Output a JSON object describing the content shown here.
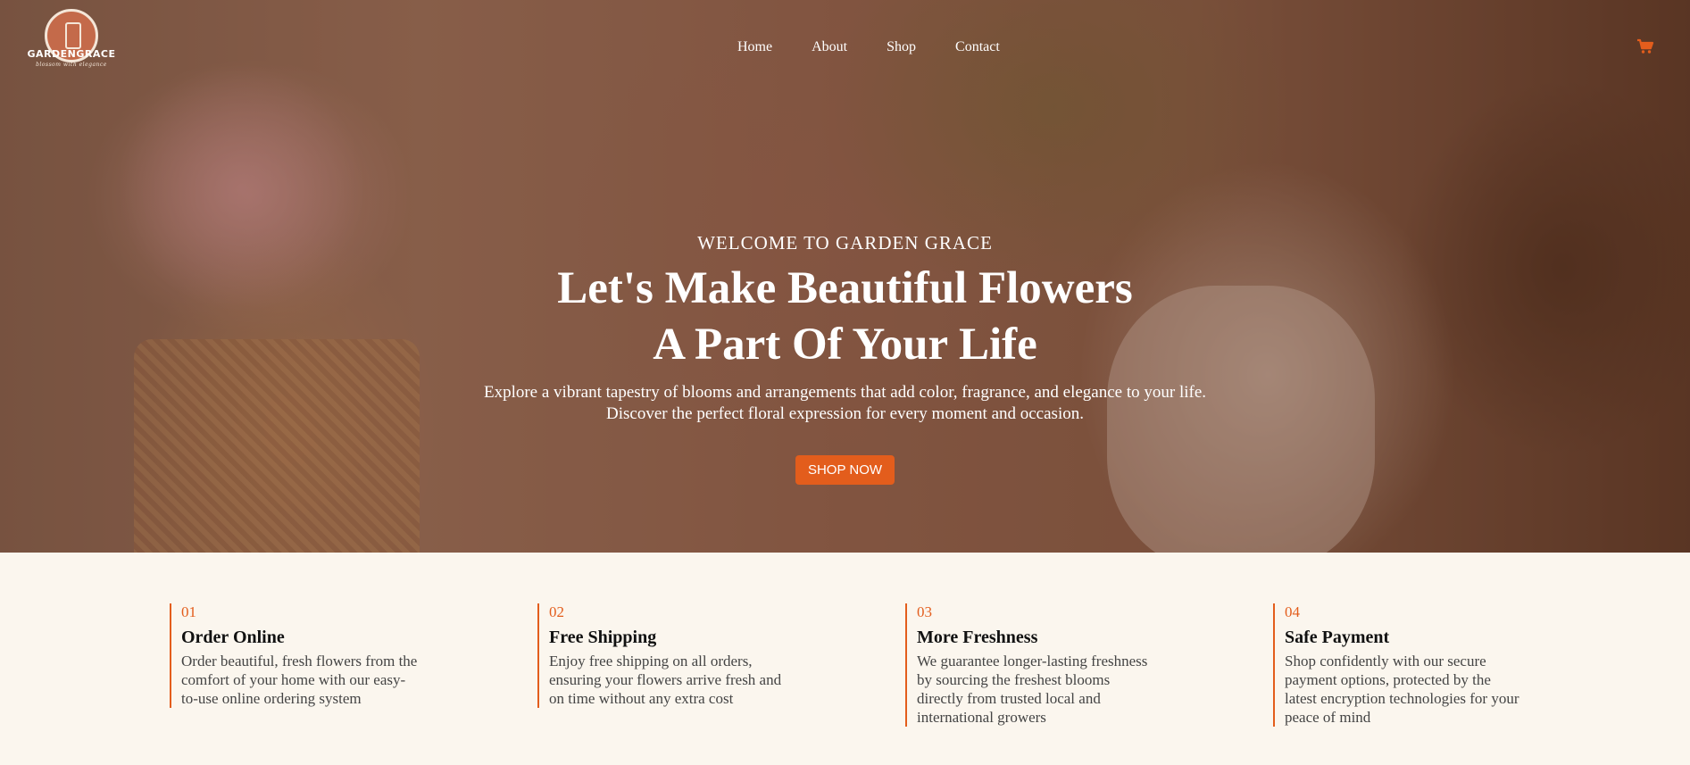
{
  "brand": {
    "name": "GARDENGRACE",
    "tagline": "blossom with elegance"
  },
  "nav": {
    "items": [
      {
        "label": "Home"
      },
      {
        "label": "About"
      },
      {
        "label": "Shop"
      },
      {
        "label": "Contact"
      }
    ],
    "cart_icon": "shopping-cart-icon"
  },
  "hero": {
    "eyebrow": "WELCOME TO GARDEN GRACE",
    "headline_line1": "Let's Make Beautiful Flowers",
    "headline_line2": "A Part Of Your Life",
    "subtext_line1": "Explore a vibrant tapestry of blooms and arrangements that add color, fragrance, and elegance to your life.",
    "subtext_line2": "Discover the perfect floral expression for every moment and occasion.",
    "cta_label": "SHOP NOW"
  },
  "features": [
    {
      "num": "01",
      "title": "Order Online",
      "text": "Order beautiful, fresh flowers from the comfort of your home with our easy-to-use online ordering system"
    },
    {
      "num": "02",
      "title": "Free Shipping",
      "text": "Enjoy free shipping on all orders, ensuring your flowers arrive fresh and on time without any extra cost"
    },
    {
      "num": "03",
      "title": "More Freshness",
      "text": "We guarantee longer-lasting freshness by sourcing the freshest blooms directly from trusted local and international growers"
    },
    {
      "num": "04",
      "title": "Safe Payment",
      "text": "Shop confidently with our secure payment options, protected by the latest encryption technologies for your peace of mind"
    }
  ],
  "colors": {
    "accent": "#e35d1c",
    "background": "#fbf6ee"
  }
}
